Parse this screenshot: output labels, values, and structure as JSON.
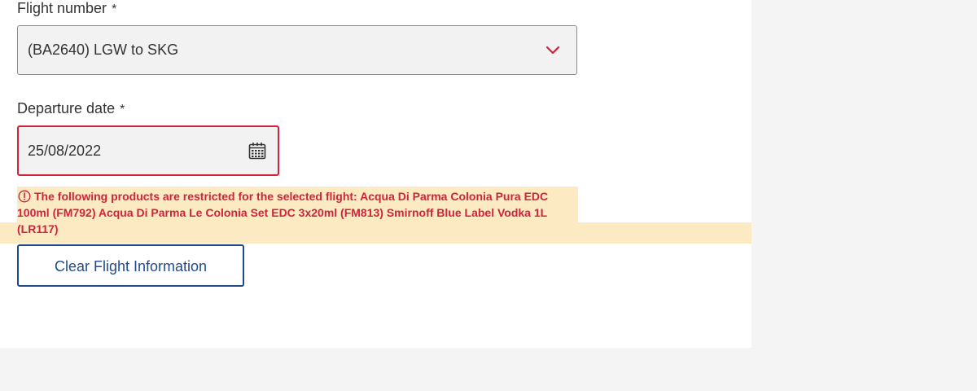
{
  "flight_number": {
    "label": "Flight number",
    "required_marker": "*",
    "selected_value": "(BA2640) LGW to SKG"
  },
  "departure_date": {
    "label": "Departure date",
    "required_marker": "*",
    "value": "25/08/2022"
  },
  "error": {
    "message": "The following products are restricted for the selected flight: Acqua Di Parma Colonia Pura EDC 100ml (FM792) Acqua Di Parma Le Colonia Set EDC 3x20ml (FM813) Smirnoff Blue Label Vodka 1L (LR117)",
    "icon": "exclamation-circle-icon"
  },
  "actions": {
    "clear_label": "Clear Flight Information"
  },
  "colors": {
    "error_red": "#d0233c",
    "highlight": "#fcebc2",
    "brand_blue": "#1f4b8e",
    "page_bg": "#f4f4f4"
  }
}
